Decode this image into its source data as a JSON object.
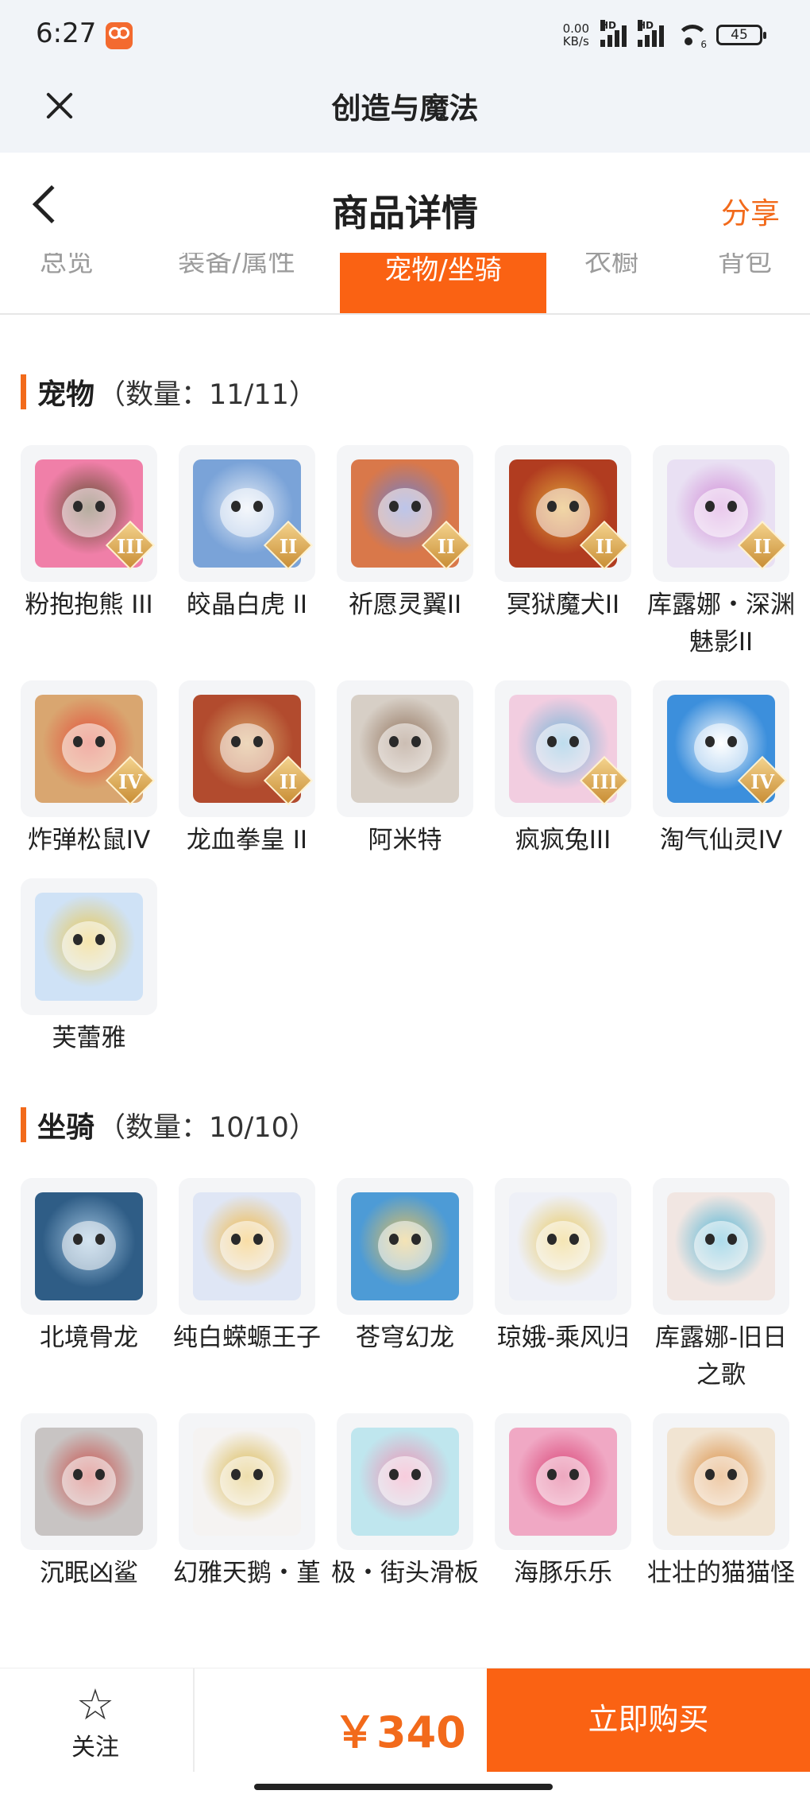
{
  "status_bar": {
    "time": "6:27",
    "net_speed_value": "0.00",
    "net_speed_unit": "KB/s",
    "signal_badge": "HD",
    "wifi_label": "6",
    "battery": "45"
  },
  "app_bar": {
    "title": "创造与魔法"
  },
  "header": {
    "title": "商品详情",
    "share_label": "分享"
  },
  "tabs": [
    {
      "label": "总览",
      "active": false
    },
    {
      "label": "装备/属性",
      "active": false
    },
    {
      "label": "宠物/坐骑",
      "active": true
    },
    {
      "label": "衣橱",
      "active": false
    },
    {
      "label": "背包",
      "active": false
    }
  ],
  "pets": {
    "title": "宠物",
    "count": "（数量：11/11）",
    "items": [
      {
        "name": "粉抱抱熊 III",
        "grade": "III",
        "color": "#f07fa8",
        "accent": "#5b4a2a"
      },
      {
        "name": "皎晶白虎 II",
        "grade": "II",
        "color": "#7aa3d8",
        "accent": "#e8eef7"
      },
      {
        "name": "祈愿灵翼II",
        "grade": "II",
        "color": "#d9784a",
        "accent": "#6c7fd0"
      },
      {
        "name": "冥狱魔犬II",
        "grade": "II",
        "color": "#b13c20",
        "accent": "#e0a53a"
      },
      {
        "name": "库露娜・深渊魅影II",
        "grade": "II",
        "color": "#e9e0f3",
        "accent": "#d089d6"
      },
      {
        "name": "炸弹松鼠IV",
        "grade": "IV",
        "color": "#d9a670",
        "accent": "#e34d3a"
      },
      {
        "name": "龙血拳皇 II",
        "grade": "II",
        "color": "#b24b2e",
        "accent": "#d8a96b"
      },
      {
        "name": "阿米特",
        "grade": "",
        "color": "#d7cfc6",
        "accent": "#8e6f58"
      },
      {
        "name": "疯疯兔III",
        "grade": "III",
        "color": "#f2cde0",
        "accent": "#6fb4d8"
      },
      {
        "name": "淘气仙灵IV",
        "grade": "IV",
        "color": "#3c8fdc",
        "accent": "#ffffff"
      },
      {
        "name": "芙蕾雅",
        "grade": "",
        "color": "#cfe2f6",
        "accent": "#e9c64c"
      }
    ]
  },
  "mounts": {
    "title": "坐骑",
    "count": "（数量：10/10）",
    "items": [
      {
        "name": "北境骨龙",
        "color": "#2f5d86",
        "accent": "#9fc2de"
      },
      {
        "name": "纯白蝾螈王子",
        "color": "#dfe6f5",
        "accent": "#f2b63c"
      },
      {
        "name": "苍穹幻龙",
        "color": "#4d9bd6",
        "accent": "#e7c15d"
      },
      {
        "name": "琼娥-乘风归",
        "color": "#eef0f7",
        "accent": "#e8c75b"
      },
      {
        "name": "库露娜-旧日之歌",
        "color": "#f1e6e2",
        "accent": "#4bb2d4"
      },
      {
        "name": "沉眠凶鲨",
        "color": "#c8c4c3",
        "accent": "#c94a45"
      },
      {
        "name": "幻雅天鹅・堇",
        "color": "#f5f3f2",
        "accent": "#d9b64a"
      },
      {
        "name": "极・街头滑板",
        "color": "#bfe6ee",
        "accent": "#ef8fb2"
      },
      {
        "name": "海豚乐乐",
        "color": "#f0a8c4",
        "accent": "#d83e72"
      },
      {
        "name": "壮壮的猫猫怪",
        "color": "#f1e4d2",
        "accent": "#d98a3c"
      }
    ]
  },
  "bottom_bar": {
    "follow_label": "关注",
    "price": "￥340",
    "buy_label": "立即购买"
  },
  "colors": {
    "accent": "#fa6213",
    "text": "#222222",
    "muted": "#9c9c9c"
  }
}
